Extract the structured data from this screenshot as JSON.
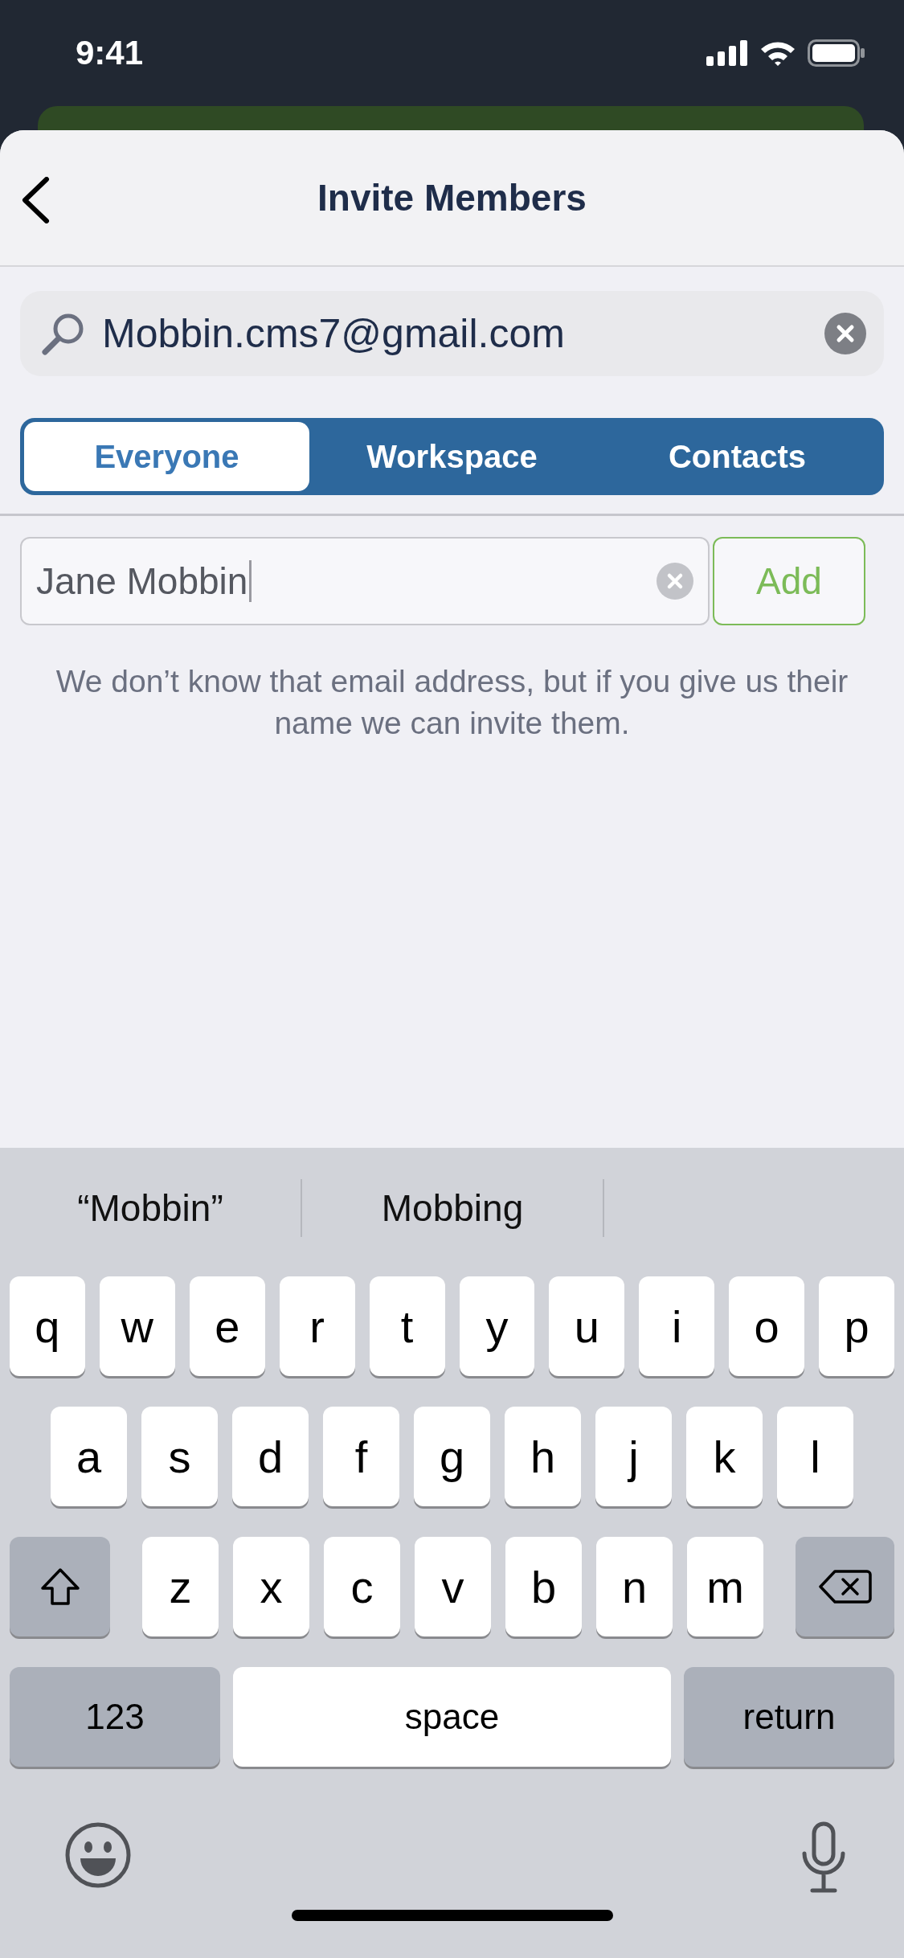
{
  "status_bar": {
    "time": "9:41"
  },
  "header": {
    "title": "Invite Members"
  },
  "search": {
    "value": "Mobbin.cms7@gmail.com"
  },
  "tabs": [
    {
      "label": "Everyone",
      "selected": true
    },
    {
      "label": "Workspace",
      "selected": false
    },
    {
      "label": "Contacts",
      "selected": false
    }
  ],
  "name_field": {
    "value": "Jane Mobbin"
  },
  "add_button": "Add",
  "hint": "We don’t know that email address, but if you give us their name we can invite them.",
  "keyboard": {
    "suggestions": [
      "“Mobbin”",
      "Mobbing"
    ],
    "rows": [
      [
        "q",
        "w",
        "e",
        "r",
        "t",
        "y",
        "u",
        "i",
        "o",
        "p"
      ],
      [
        "a",
        "s",
        "d",
        "f",
        "g",
        "h",
        "j",
        "k",
        "l"
      ],
      [
        "z",
        "x",
        "c",
        "v",
        "b",
        "n",
        "m"
      ]
    ],
    "bottom": [
      {
        "label": "123",
        "kind": "mode"
      },
      {
        "label": "space",
        "kind": "space"
      },
      {
        "label": "return",
        "kind": "return"
      }
    ]
  }
}
